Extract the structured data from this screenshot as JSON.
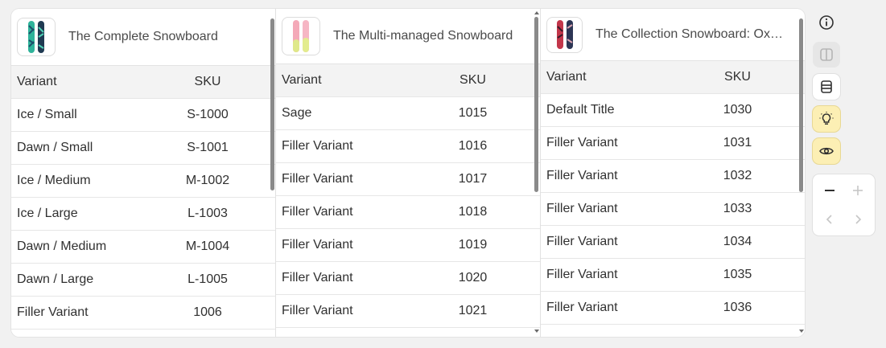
{
  "panels": [
    {
      "title": "The Complete Snowboard",
      "headers": {
        "variant": "Variant",
        "sku": "SKU"
      },
      "rows": [
        {
          "variant": "Ice / Small",
          "sku": "S-1000"
        },
        {
          "variant": "Dawn / Small",
          "sku": "S-1001"
        },
        {
          "variant": "Ice / Medium",
          "sku": "M-1002"
        },
        {
          "variant": "Ice / Large",
          "sku": "L-1003"
        },
        {
          "variant": "Dawn / Medium",
          "sku": "M-1004"
        },
        {
          "variant": "Dawn / Large",
          "sku": "L-1005"
        },
        {
          "variant": "Filler Variant",
          "sku": "1006"
        }
      ]
    },
    {
      "title": "The Multi-managed Snowboard",
      "headers": {
        "variant": "Variant",
        "sku": "SKU"
      },
      "rows": [
        {
          "variant": "Sage",
          "sku": "1015"
        },
        {
          "variant": "Filler Variant",
          "sku": "1016"
        },
        {
          "variant": "Filler Variant",
          "sku": "1017"
        },
        {
          "variant": "Filler Variant",
          "sku": "1018"
        },
        {
          "variant": "Filler Variant",
          "sku": "1019"
        },
        {
          "variant": "Filler Variant",
          "sku": "1020"
        },
        {
          "variant": "Filler Variant",
          "sku": "1021"
        }
      ]
    },
    {
      "title": "The Collection Snowboard: Oxygen",
      "headers": {
        "variant": "Variant",
        "sku": "SKU"
      },
      "rows": [
        {
          "variant": "Default Title",
          "sku": "1030"
        },
        {
          "variant": "Filler Variant",
          "sku": "1031"
        },
        {
          "variant": "Filler Variant",
          "sku": "1032"
        },
        {
          "variant": "Filler Variant",
          "sku": "1033"
        },
        {
          "variant": "Filler Variant",
          "sku": "1034"
        },
        {
          "variant": "Filler Variant",
          "sku": "1035"
        },
        {
          "variant": "Filler Variant",
          "sku": "1036"
        }
      ]
    }
  ],
  "toolbar": {
    "icons": [
      "info-icon",
      "split-view-icon",
      "table-rows-icon",
      "lightbulb-icon",
      "eye-icon"
    ],
    "zoom_icons": [
      "minus-icon",
      "plus-icon",
      "chevron-left-icon",
      "chevron-right-icon"
    ]
  },
  "colors": {
    "highlight": "#fcefb4",
    "header_bg": "#f3f3f3",
    "board_bg": "#ffffff"
  }
}
